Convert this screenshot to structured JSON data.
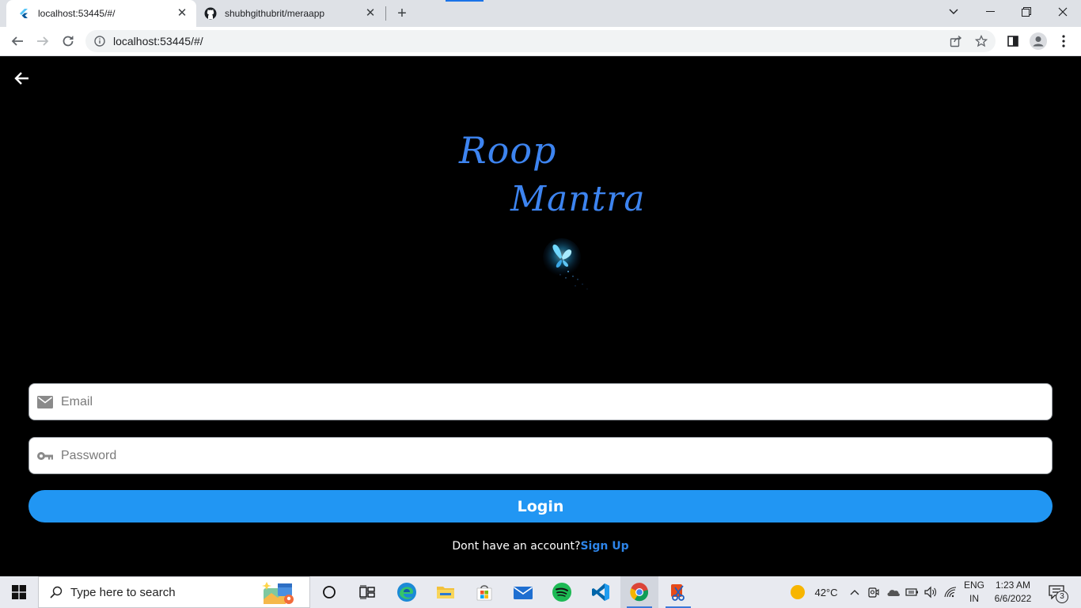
{
  "browser": {
    "tabs": [
      {
        "title": "localhost:53445/#/",
        "active": true,
        "favicon": "flutter-icon"
      },
      {
        "title": "shubhgithubrit/meraapp",
        "active": false,
        "favicon": "github-icon"
      }
    ],
    "url": "localhost:53445/#/"
  },
  "app": {
    "logo_line1": "Roop",
    "logo_line2": "Mantra",
    "email_placeholder": "Email",
    "password_placeholder": "Password",
    "login_label": "Login",
    "signup_prompt": "Dont have an account?",
    "signup_link": "Sign Up",
    "colors": {
      "accent": "#2196f3",
      "logo": "#3d84f0",
      "background": "#000000"
    }
  },
  "taskbar": {
    "search_placeholder": "Type here to search",
    "weather": "42°C",
    "lang_top": "ENG",
    "lang_bottom": "IN",
    "time": "1:23 AM",
    "date": "6/6/2022",
    "notification_count": "3"
  }
}
